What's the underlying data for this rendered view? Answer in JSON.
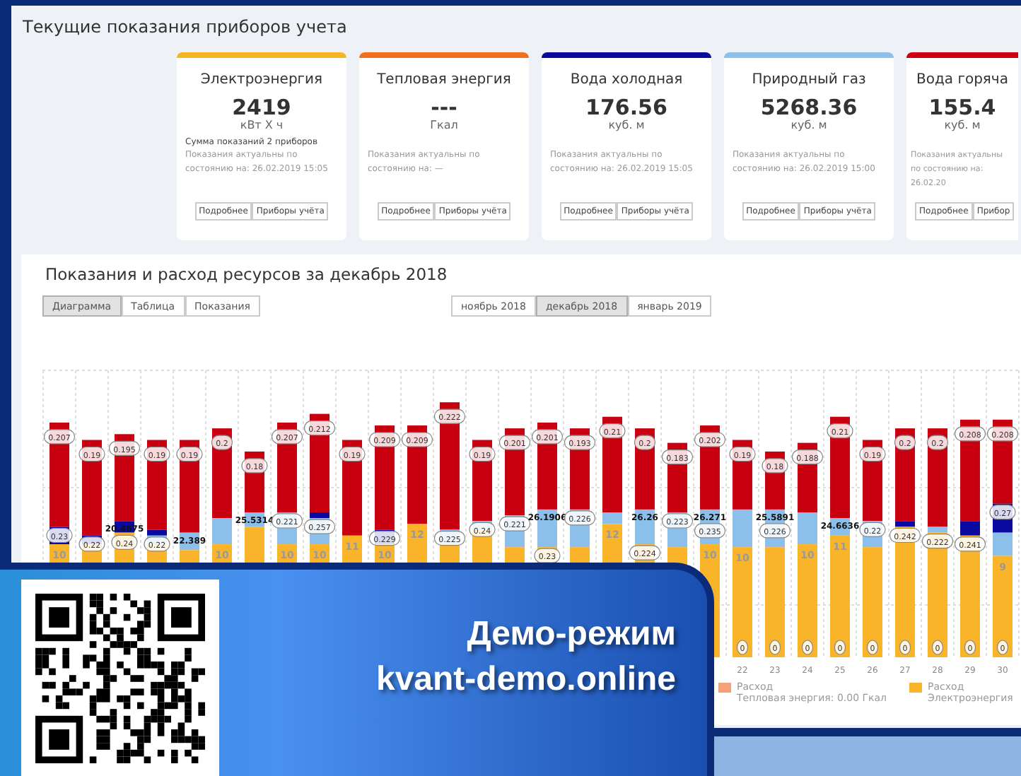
{
  "meters": {
    "title": "Текущие показания приборов учета",
    "cards": [
      {
        "title": "Электроэнергия",
        "color": "#f5b623",
        "value": "2419",
        "unit": "кВт Х ч",
        "note": "Сумма показаний 2 приборов",
        "status": "Показания актуальны по состоянию на: 26.02.2019 15:05",
        "buttons": [
          "Подробнее",
          "Приборы учёта"
        ]
      },
      {
        "title": "Тепловая энергия",
        "color": "#f07020",
        "value": "---",
        "unit": "Гкал",
        "status": "Показания актуальны по состоянию на: —",
        "buttons": [
          "Подробнее",
          "Приборы учёта"
        ]
      },
      {
        "title": "Вода холодная",
        "color": "#0a0a9a",
        "value": "176.56",
        "unit": "куб. м",
        "status": "Показания актуальны по состоянию на: 26.02.2019 15:05",
        "buttons": [
          "Подробнее",
          "Приборы учёта"
        ]
      },
      {
        "title": "Природный газ",
        "color": "#8fc0ea",
        "value": "5268.36",
        "unit": "куб. м",
        "status": "Показания актуальны по состоянию на: 26.02.2019 15:00",
        "buttons": [
          "Подробнее",
          "Приборы учёта"
        ]
      },
      {
        "title": "Вода горяча",
        "color": "#cc0010",
        "value": "155.4",
        "unit": "куб. м",
        "status": "Показания актуальны по состоянию на: 26.02.20",
        "buttons": [
          "Подробнее",
          "Прибор"
        ]
      }
    ]
  },
  "chart": {
    "title": "Показания и расход ресурсов за декабрь 2018",
    "views": [
      {
        "label": "Диаграмма",
        "selected": true
      },
      {
        "label": "Таблица",
        "selected": false
      },
      {
        "label": "Показания",
        "selected": false
      }
    ],
    "months": [
      {
        "label": "ноябрь 2018",
        "selected": false
      },
      {
        "label": "декабрь 2018",
        "selected": true
      },
      {
        "label": "январь 2019",
        "selected": false
      }
    ],
    "columns": [
      {
        "segments": [
          {
            "kind": "red",
            "label": "0.207"
          },
          {
            "kind": "darkblue",
            "label": "0.23"
          },
          {
            "kind": "orange",
            "label": "10"
          }
        ]
      },
      {
        "segments": [
          {
            "kind": "red",
            "label": "0.19"
          },
          {
            "kind": "darkblue",
            "label": "0.22"
          },
          {
            "kind": "orange"
          }
        ]
      },
      {
        "total": "20.4675",
        "segments": [
          {
            "kind": "red",
            "label": "0.195"
          },
          {
            "kind": "darkblue",
            "label": "0.24"
          },
          {
            "kind": "orange"
          }
        ]
      },
      {
        "segments": [
          {
            "kind": "red",
            "label": "0.19"
          },
          {
            "kind": "darkblue"
          },
          {
            "kind": "lightblue",
            "label": "0.22"
          },
          {
            "kind": "orange"
          }
        ]
      },
      {
        "total": "22.389",
        "segments": [
          {
            "kind": "red",
            "label": "0.19"
          },
          {
            "kind": "lightblue"
          },
          {
            "kind": "orange"
          }
        ]
      },
      {
        "segments": [
          {
            "kind": "red",
            "label": "0.2"
          },
          {
            "kind": "lightblue"
          },
          {
            "kind": "orange",
            "label": "10"
          }
        ]
      },
      {
        "total": "25.5314",
        "segments": [
          {
            "kind": "red",
            "label": "0.18"
          },
          {
            "kind": "lightblue"
          },
          {
            "kind": "orange"
          }
        ]
      },
      {
        "segments": [
          {
            "kind": "red",
            "label": "0.207"
          },
          {
            "kind": "lightblue",
            "label": "0.221"
          },
          {
            "kind": "orange",
            "label": "10"
          }
        ]
      },
      {
        "segments": [
          {
            "kind": "red",
            "label": "0.212"
          },
          {
            "kind": "darkblue"
          },
          {
            "kind": "lightblue",
            "label": "0.257"
          },
          {
            "kind": "orange",
            "label": "10"
          }
        ]
      },
      {
        "segments": [
          {
            "kind": "red",
            "label": "0.19"
          },
          {
            "kind": "orange",
            "label": "11"
          }
        ]
      },
      {
        "segments": [
          {
            "kind": "red",
            "label": "0.209"
          },
          {
            "kind": "darkblue",
            "label": "0.229"
          },
          {
            "kind": "orange",
            "label": "10"
          }
        ]
      },
      {
        "segments": [
          {
            "kind": "red",
            "label": "0.209"
          },
          {
            "kind": "orange",
            "label": "12"
          }
        ]
      },
      {
        "segments": [
          {
            "kind": "red",
            "label": "0.222"
          },
          {
            "kind": "lightblue",
            "label": "0.225"
          },
          {
            "kind": "orange"
          }
        ]
      },
      {
        "segments": [
          {
            "kind": "red",
            "label": "0.19"
          },
          {
            "kind": "lightblue",
            "label": "0.24"
          },
          {
            "kind": "orange"
          }
        ]
      },
      {
        "segments": [
          {
            "kind": "red",
            "label": "0.201"
          },
          {
            "kind": "lightblue",
            "label": "0.221"
          },
          {
            "kind": "orange"
          }
        ]
      },
      {
        "total": "26.1906",
        "segments": [
          {
            "kind": "red",
            "label": "0.201"
          },
          {
            "kind": "lightblue"
          },
          {
            "kind": "orange",
            "label": "0.23"
          }
        ]
      },
      {
        "segments": [
          {
            "kind": "red",
            "label": "0.193"
          },
          {
            "kind": "lightblue",
            "label": "0.226"
          },
          {
            "kind": "orange"
          }
        ]
      },
      {
        "segments": [
          {
            "kind": "red",
            "label": "0.21"
          },
          {
            "kind": "lightblue"
          },
          {
            "kind": "orange",
            "label": "12"
          }
        ]
      },
      {
        "total": "26.26",
        "segments": [
          {
            "kind": "red",
            "label": "0.2"
          },
          {
            "kind": "lightblue"
          },
          {
            "kind": "orange",
            "label": "0.224"
          }
        ]
      },
      {
        "segments": [
          {
            "kind": "red",
            "label": "0.183"
          },
          {
            "kind": "lightblue",
            "label": "0.223"
          },
          {
            "kind": "orange"
          }
        ]
      },
      {
        "total": "26.271",
        "segments": [
          {
            "kind": "red",
            "label": "0.202"
          },
          {
            "kind": "lightblue",
            "label": "0.235"
          },
          {
            "kind": "orange",
            "label": "10"
          }
        ]
      },
      {
        "day": "22",
        "base_label": "0",
        "segments": [
          {
            "kind": "red",
            "label": "0.19"
          },
          {
            "kind": "lightblue"
          },
          {
            "kind": "orange",
            "label": "10"
          }
        ]
      },
      {
        "day": "23",
        "base_label": "0",
        "total": "25.5891",
        "segments": [
          {
            "kind": "red",
            "label": "0.18"
          },
          {
            "kind": "lightblue",
            "label": "0.226"
          },
          {
            "kind": "orange"
          }
        ]
      },
      {
        "day": "24",
        "base_label": "0",
        "segments": [
          {
            "kind": "red",
            "label": "0.188"
          },
          {
            "kind": "lightblue"
          },
          {
            "kind": "orange",
            "label": "10"
          }
        ]
      },
      {
        "day": "25",
        "base_label": "0",
        "total": "24.6636",
        "segments": [
          {
            "kind": "red",
            "label": "0.21"
          },
          {
            "kind": "lightblue"
          },
          {
            "kind": "orange",
            "label": "11"
          }
        ]
      },
      {
        "day": "26",
        "base_label": "0",
        "segments": [
          {
            "kind": "red",
            "label": "0.19"
          },
          {
            "kind": "lightblue",
            "label": "0.22"
          },
          {
            "kind": "orange"
          }
        ]
      },
      {
        "day": "27",
        "base_label": "0",
        "segments": [
          {
            "kind": "red",
            "label": "0.2"
          },
          {
            "kind": "darkblue"
          },
          {
            "kind": "orange",
            "label": "0.242"
          }
        ]
      },
      {
        "day": "28",
        "base_label": "0",
        "segments": [
          {
            "kind": "red",
            "label": "0.2"
          },
          {
            "kind": "lightblue"
          },
          {
            "kind": "orange",
            "label": "0.222"
          }
        ]
      },
      {
        "day": "29",
        "base_label": "0",
        "segments": [
          {
            "kind": "red",
            "label": "0.208"
          },
          {
            "kind": "darkblue"
          },
          {
            "kind": "orange",
            "label": "0.241"
          }
        ]
      },
      {
        "day": "30",
        "base_label": "0",
        "segments": [
          {
            "kind": "red",
            "label": "0.208"
          },
          {
            "kind": "darkblue",
            "label": "0.27"
          },
          {
            "kind": "lightblue"
          },
          {
            "kind": "orange",
            "label": "9"
          }
        ]
      }
    ],
    "legend": [
      {
        "label": "Расход",
        "detail": "Тепловая энергия: 0.00 Гкал",
        "color": "#f4a07a"
      },
      {
        "label": "Расход",
        "detail": "Электроэнергия",
        "color": "#f9b42a"
      }
    ]
  },
  "banner": {
    "title": "Демо-режим",
    "url": "kvant-demo.online"
  }
}
